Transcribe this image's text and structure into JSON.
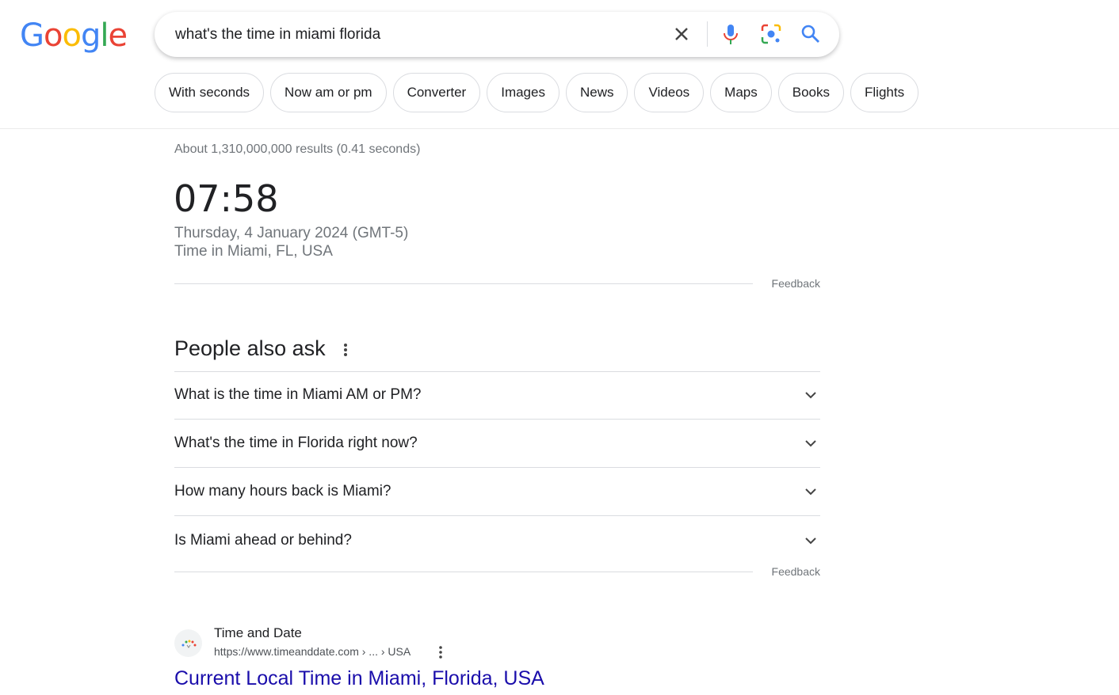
{
  "logo": "Google",
  "search": {
    "query": "what's the time in miami florida"
  },
  "chips": [
    "With seconds",
    "Now am or pm",
    "Converter",
    "Images",
    "News",
    "Videos",
    "Maps",
    "Books",
    "Flights"
  ],
  "stats": "About 1,310,000,000 results (0.41 seconds)",
  "clock": {
    "time": "07:58",
    "date": "Thursday, 4 January 2024 (GMT-5)",
    "location": "Time in Miami, FL, USA"
  },
  "feedback": "Feedback",
  "paa": {
    "title": "People also ask",
    "questions": [
      "What is the time in Miami AM or PM?",
      "What's the time in Florida right now?",
      "How many hours back is Miami?",
      "Is Miami ahead or behind?"
    ]
  },
  "result": {
    "site": "Time and Date",
    "url": "https://www.timeanddate.com › ... › USA",
    "title": "Current Local Time in Miami, Florida, USA"
  },
  "colors": {
    "link": "#1a0dab",
    "blue": "#4285f4",
    "red": "#ea4335",
    "yellow": "#fbbc05",
    "green": "#34a853"
  }
}
